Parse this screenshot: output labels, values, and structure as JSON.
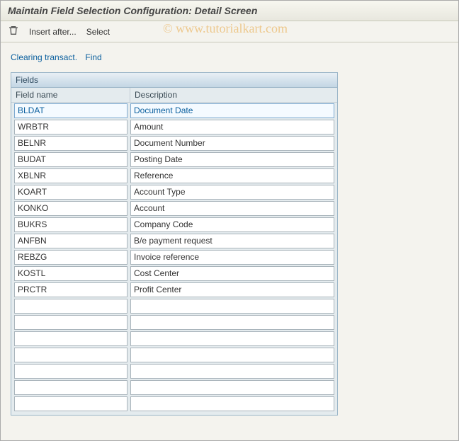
{
  "title": "Maintain Field Selection Configuration: Detail Screen",
  "watermark": "© www.tutorialkart.com",
  "toolbar": {
    "insert_after": "Insert after...",
    "select": "Select"
  },
  "links": {
    "clearing_transact": "Clearing transact.",
    "find": "Find"
  },
  "panel": {
    "title": "Fields",
    "col1": "Field name",
    "col2": "Description",
    "rows": [
      {
        "name": "BLDAT",
        "desc": "Document Date",
        "selected": true
      },
      {
        "name": "WRBTR",
        "desc": "Amount"
      },
      {
        "name": "BELNR",
        "desc": "Document Number"
      },
      {
        "name": "BUDAT",
        "desc": "Posting Date"
      },
      {
        "name": "XBLNR",
        "desc": "Reference"
      },
      {
        "name": "KOART",
        "desc": "Account Type"
      },
      {
        "name": "KONKO",
        "desc": "Account"
      },
      {
        "name": "BUKRS",
        "desc": "Company Code"
      },
      {
        "name": "ANFBN",
        "desc": "B/e payment request"
      },
      {
        "name": "REBZG",
        "desc": "Invoice reference"
      },
      {
        "name": "KOSTL",
        "desc": "Cost Center"
      },
      {
        "name": "PRCTR",
        "desc": "Profit Center"
      },
      {
        "name": "",
        "desc": ""
      },
      {
        "name": "",
        "desc": ""
      },
      {
        "name": "",
        "desc": ""
      },
      {
        "name": "",
        "desc": ""
      },
      {
        "name": "",
        "desc": ""
      },
      {
        "name": "",
        "desc": ""
      },
      {
        "name": "",
        "desc": ""
      }
    ]
  }
}
